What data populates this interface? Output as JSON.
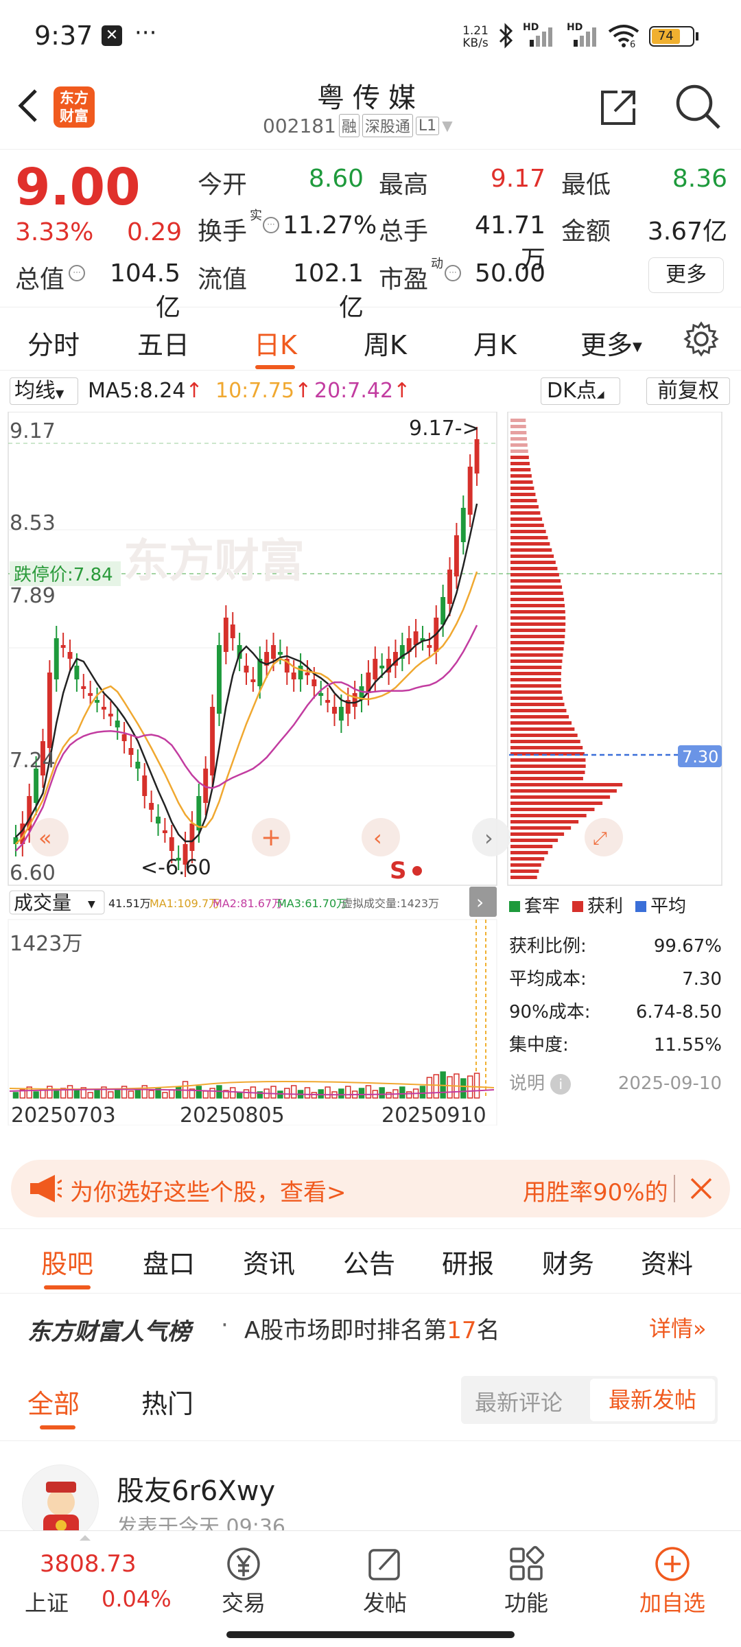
{
  "status_bar": {
    "time": "9:37",
    "speed_value": "1.21",
    "speed_unit": "KB/s",
    "battery": "74",
    "dots": "···",
    "hd1": "HD",
    "hd2": "HD",
    "wifi_num": "6"
  },
  "header": {
    "logo_line1": "东方",
    "logo_line2": "财富",
    "stock_name": "粤传媒",
    "code": "002181",
    "tag_rong": "融",
    "tag_sgt": "深股通",
    "tag_level": "L1"
  },
  "quote": {
    "price": "9.00",
    "change_pct": "3.33%",
    "change": "0.29",
    "open_label": "今开",
    "open": "8.60",
    "high_label": "最高",
    "high": "9.17",
    "low_label": "最低",
    "low": "8.36",
    "turnover_label": "换手",
    "turnover_sup": "实",
    "turnover": "11.27%",
    "volume_label": "总手",
    "volume": "41.71万",
    "amount_label": "金额",
    "amount": "3.67亿",
    "mktcap_label": "总值",
    "mktcap": "104.5亿",
    "float_label": "流值",
    "float": "102.1亿",
    "pe_label": "市盈",
    "pe_sup": "动",
    "pe": "50.00",
    "more": "更多"
  },
  "period_tabs": [
    "分时",
    "五日",
    "日K",
    "周K",
    "月K",
    "更多"
  ],
  "active_period": "日K",
  "chart": {
    "ma_selector": "均线",
    "ma5": "MA5:8.24",
    "ma10": "10:7.75",
    "ma20": "20:7.42",
    "dk_label": "DK点",
    "adjust_label": "前复权",
    "y_top": "9.17",
    "y_2": "8.53",
    "y_3": "7.89",
    "y_4": "7.24",
    "y_bottom": "6.60",
    "high_marker": "9.17->",
    "low_marker": "<-6.60",
    "limit_down": "跌停价:7.84",
    "watermark": "东方财富",
    "avg_cost_marker": "7.30",
    "s_marker": "S",
    "vol_selector": "成交量",
    "vol_legend": "41.51万",
    "vol_ma1": "MA1:109.7万",
    "vol_ma2": "MA2:81.67万",
    "vol_ma3": "MA3:61.70万",
    "vol_virtual": "虚拟成交量:1423万",
    "vol_max": "1423万",
    "dates": [
      "20250703",
      "20250805",
      "20250910"
    ],
    "colors": {
      "up": "#d6302b",
      "down": "#1e9a3c",
      "ma5": "#222222",
      "ma10": "#f0a830",
      "ma20": "#c23ca0"
    }
  },
  "chip": {
    "legend_trapped": "套牢",
    "legend_profit": "获利",
    "legend_avg": "平均",
    "rows": [
      {
        "label": "获利比例:",
        "value": "99.67%"
      },
      {
        "label": "平均成本:",
        "value": "7.30"
      },
      {
        "label": "90%成本:",
        "value": "6.74-8.50"
      },
      {
        "label": "集中度:",
        "value": "11.55%"
      }
    ],
    "note_label": "说明",
    "note_date": "2025-09-10"
  },
  "banner": {
    "left_text": "为你选好这些个股，查看>",
    "right_text": "用胜率90%的"
  },
  "sub_tabs": [
    "股吧",
    "盘口",
    "资讯",
    "公告",
    "研报",
    "财务",
    "资料"
  ],
  "active_sub_tab": "股吧",
  "rank": {
    "title": "东方财富人气榜",
    "sep": "·",
    "text_pre": "A股市场即时排名第",
    "rank_num": "17",
    "text_post": "名",
    "detail": "详情"
  },
  "feed_tabs": {
    "all": "全部",
    "hot": "热门",
    "latest_comment": "最新评论",
    "latest_post": "最新发帖"
  },
  "post": {
    "user": "股友6r6Xwy",
    "time": "发表于今天 09:36"
  },
  "bottom_bar": {
    "index_value": "3808.73",
    "index_name": "上证",
    "index_change": "0.04%",
    "trade": "交易",
    "post": "发帖",
    "function": "功能",
    "add": "加自选"
  }
}
